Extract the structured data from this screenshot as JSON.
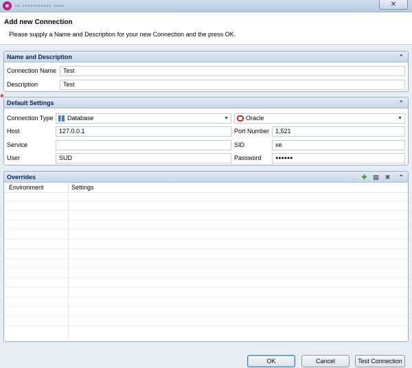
{
  "window": {
    "title_blur": "▪▪ ▪▪▪▪▪▪▪▪▪▪▪ ▪▪▪▪",
    "close_label": "✕"
  },
  "header": {
    "title": "Add new Connection",
    "subtitle": "Please supply a Name and Description for your new Connection and the press OK."
  },
  "name_section": {
    "title": "Name and Description",
    "collapse": "⌃",
    "connection_name_label": "Connection Name",
    "connection_name_value": "Test",
    "description_label": "Description",
    "description_value": "Test"
  },
  "default_settings": {
    "title": "Default Settings",
    "collapse": "⌃",
    "connection_type_label": "Connection Type",
    "connection_type_value": "Database",
    "db_vendor_value": "Oracle",
    "host_label": "Host",
    "host_value": "127.0.0.1",
    "port_label": "Port Number",
    "port_value": "1,521",
    "service_label": "Service",
    "service_value": "",
    "sid_label": "SID",
    "sid_value": "xe",
    "user_label": "User",
    "user_value": "SUD",
    "password_label": "Password",
    "password_value": "●●●●●●"
  },
  "overrides": {
    "title": "Overrides",
    "collapse": "⌃",
    "add_icon": "✚",
    "edit_icon": "▤",
    "delete_icon": "✖",
    "columns": [
      "Environment",
      "Settings"
    ]
  },
  "buttons": {
    "ok": "OK",
    "cancel": "Cancel",
    "test_connection": "Test Connection"
  },
  "colors": {
    "section_header": "#c6d6ea",
    "accent": "#3c7fb1"
  }
}
